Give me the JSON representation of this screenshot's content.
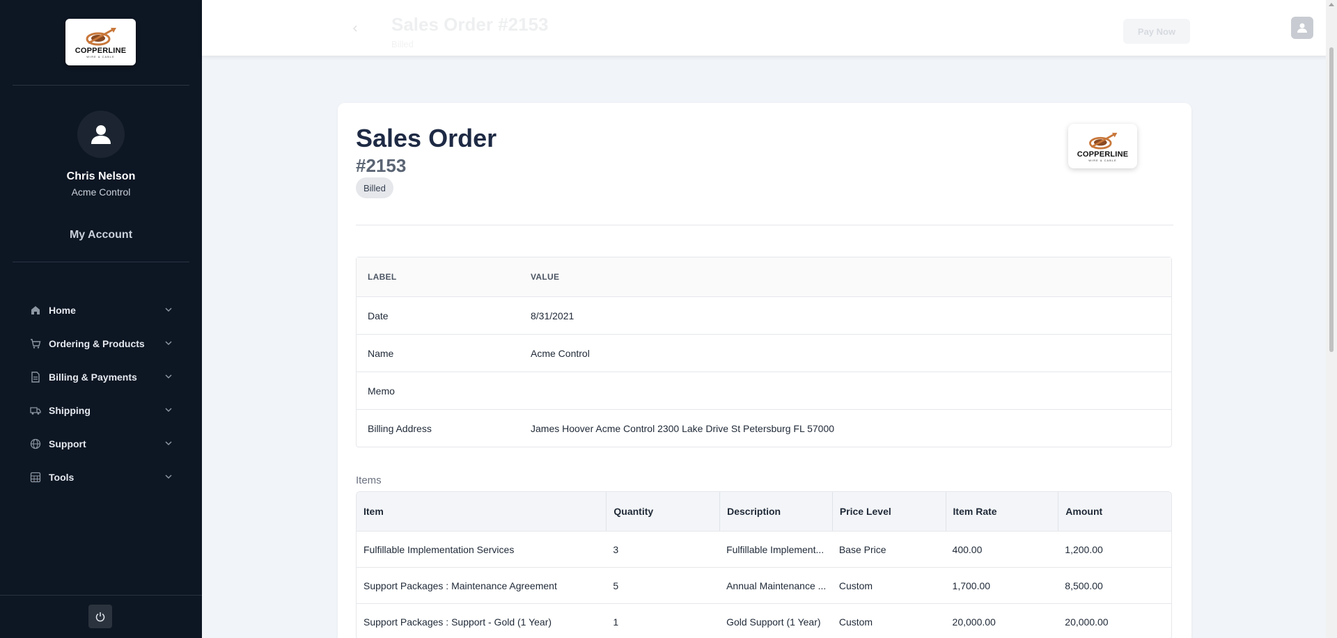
{
  "brand": {
    "logo_text": "COPPERLINE",
    "logo_subtext": "WIRE & CABLE",
    "colors": {
      "sidebar_bg": "#0d1623",
      "accent": "#c8773a",
      "title": "#1e2a44"
    }
  },
  "sidebar": {
    "user_name": "Chris Nelson",
    "user_company": "Acme Control",
    "my_account": "My Account",
    "nav": [
      {
        "label": "Home",
        "icon": "home-icon"
      },
      {
        "label": "Ordering & Products",
        "icon": "cart-icon"
      },
      {
        "label": "Billing & Payments",
        "icon": "document-icon"
      },
      {
        "label": "Shipping",
        "icon": "truck-icon"
      },
      {
        "label": "Support",
        "icon": "globe-icon"
      },
      {
        "label": "Tools",
        "icon": "grid-icon"
      }
    ],
    "power_icon": "power-icon"
  },
  "header": {
    "title": "Sales Order #2153",
    "subtitle": "Billed",
    "action_label": "Pay Now"
  },
  "order": {
    "title": "Sales Order",
    "number": "#2153",
    "status": "Billed"
  },
  "details": {
    "headers": {
      "label": "LABEL",
      "value": "VALUE"
    },
    "rows": [
      {
        "label": "Date",
        "value": "8/31/2021"
      },
      {
        "label": "Name",
        "value": "Acme Control"
      },
      {
        "label": "Memo",
        "value": ""
      },
      {
        "label": "Billing Address",
        "value": "James Hoover Acme Control 2300 Lake Drive St Petersburg FL 57000"
      }
    ]
  },
  "items": {
    "section_label": "Items",
    "columns": [
      "Item",
      "Quantity",
      "Description",
      "Price Level",
      "Item Rate",
      "Amount"
    ],
    "rows": [
      [
        "Fulfillable Implementation Services",
        "3",
        "Fulfillable Implement...",
        "Base Price",
        "400.00",
        "1,200.00"
      ],
      [
        "Support Packages : Maintenance Agreement",
        "5",
        "Annual Maintenance ...",
        "Custom",
        "1,700.00",
        "8,500.00"
      ],
      [
        "Support Packages : Support - Gold (1 Year)",
        "1",
        "Gold Support (1 Year)",
        "Custom",
        "20,000.00",
        "20,000.00"
      ]
    ]
  }
}
